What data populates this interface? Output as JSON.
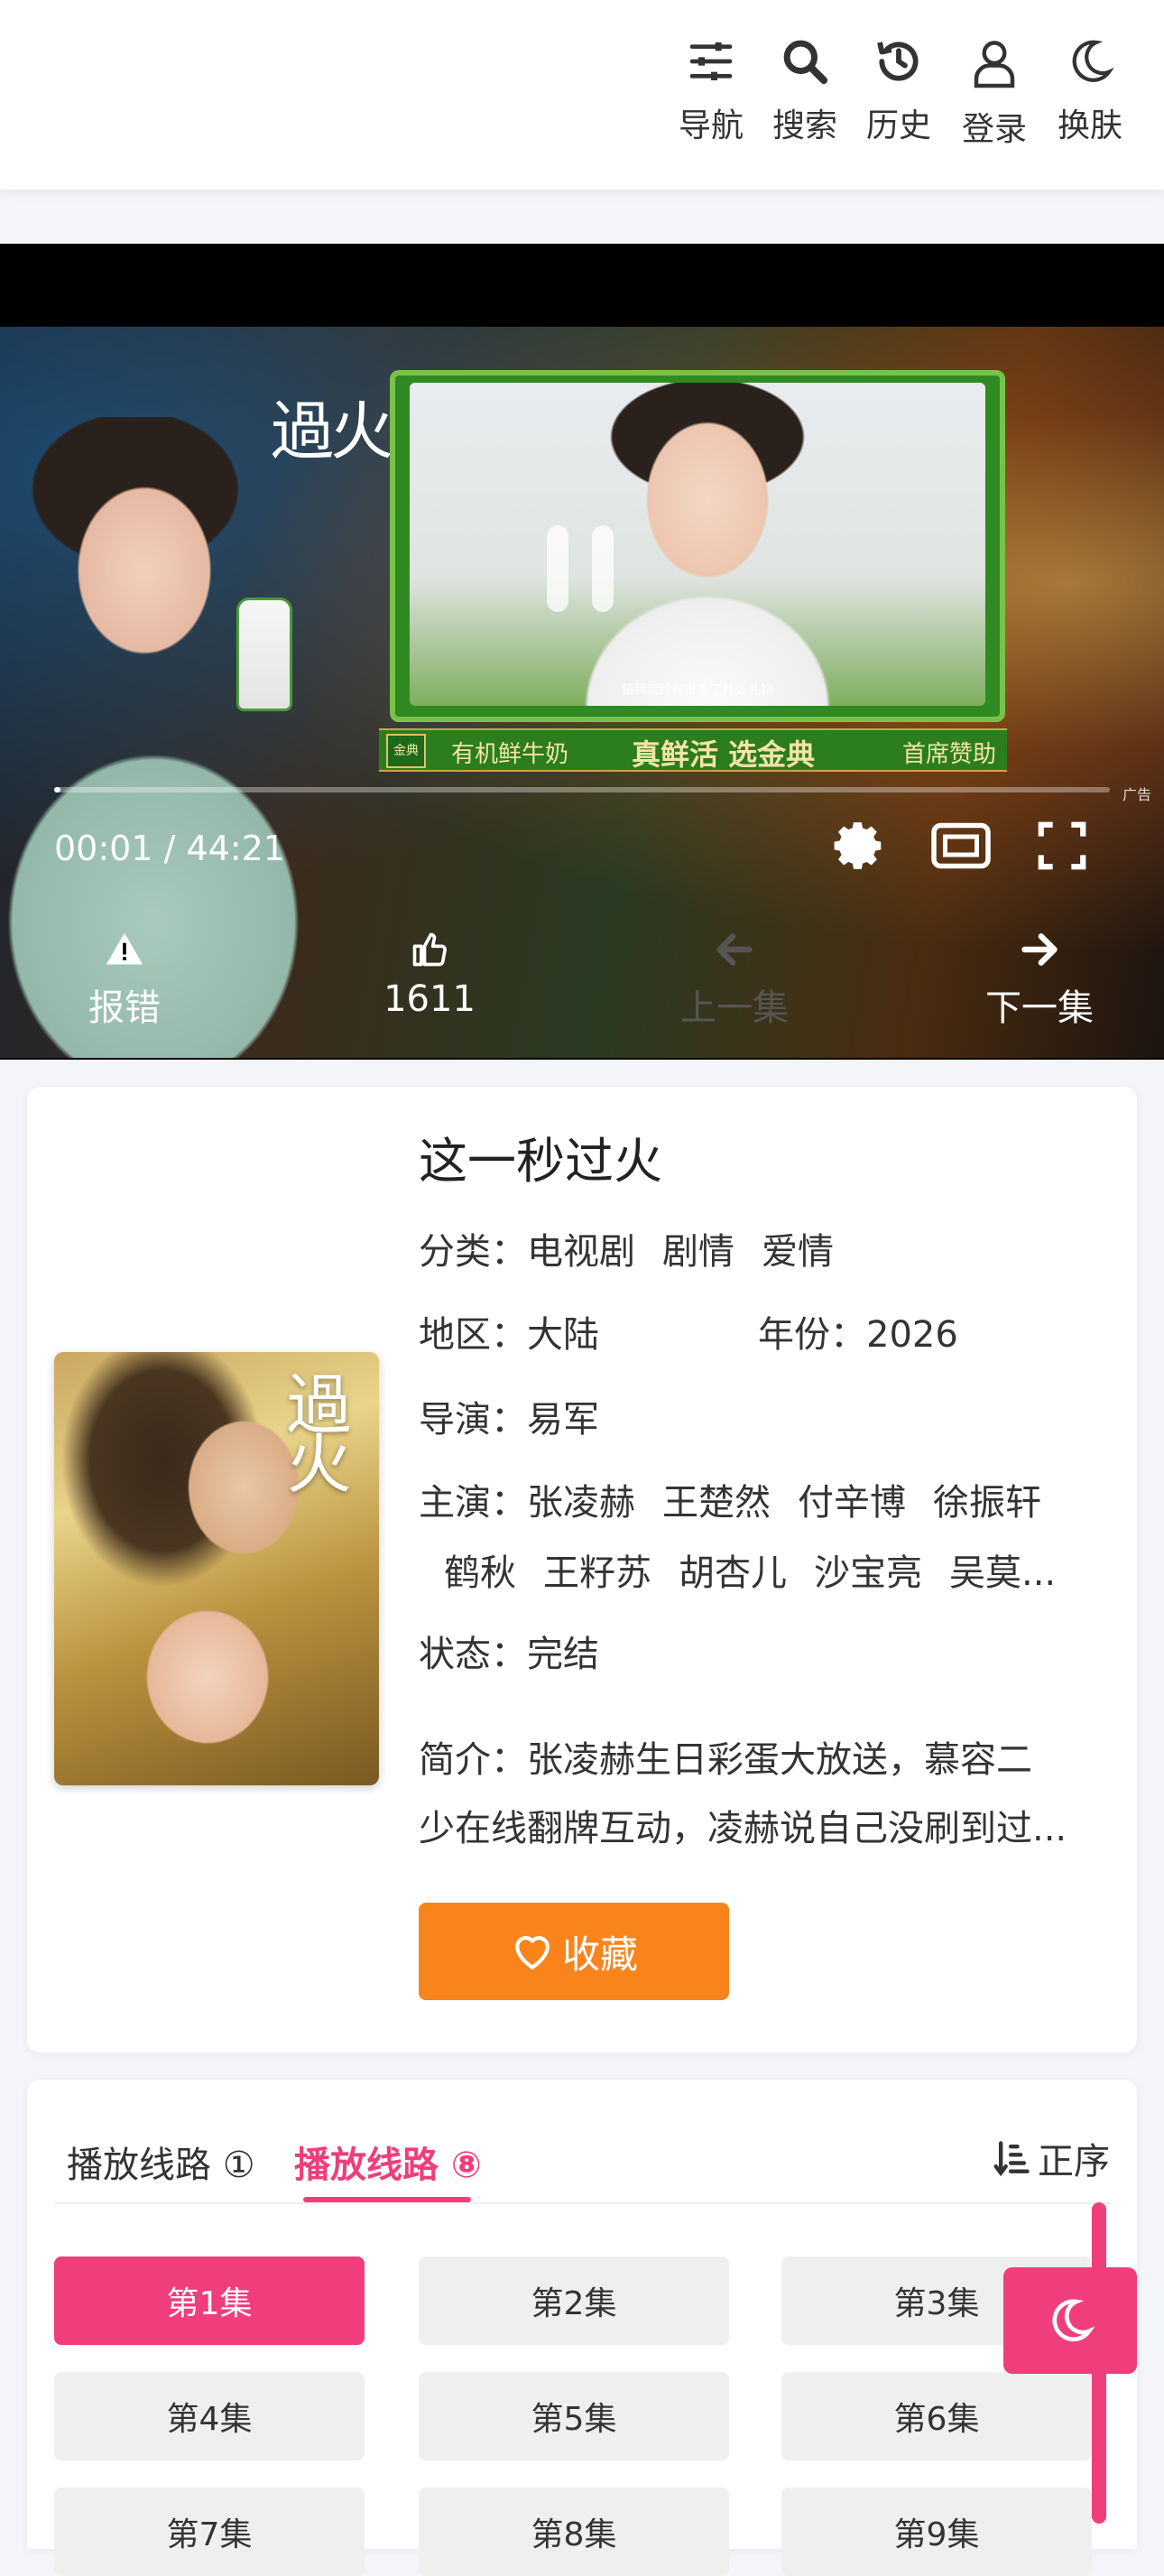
{
  "header": {
    "nav": [
      {
        "label": "导航",
        "icon": "sliders-icon"
      },
      {
        "label": "搜索",
        "icon": "search-icon"
      },
      {
        "label": "历史",
        "icon": "history-icon"
      },
      {
        "label": "登录",
        "icon": "user-icon"
      },
      {
        "label": "换肤",
        "icon": "moon-icon"
      }
    ]
  },
  "player": {
    "ad_caption": "猜猜我给你准备了什么礼物",
    "ad_brand_left": "過火",
    "ad_strip": {
      "logo": "金典",
      "item1": "有机鲜牛奶",
      "item2": "真鲜活 选金典",
      "item3": "首席赞助"
    },
    "ad_tag": "广告",
    "progress": 0.0004,
    "time": "00:01 / 44:21",
    "actions": [
      {
        "label": "报错",
        "icon": "warning-icon",
        "enabled": true
      },
      {
        "label": "1611",
        "icon": "thumbs-up-icon",
        "enabled": true
      },
      {
        "label": "上一集",
        "icon": "arrow-left-icon",
        "enabled": false
      },
      {
        "label": "下一集",
        "icon": "arrow-right-icon",
        "enabled": true
      }
    ]
  },
  "info": {
    "poster_title": "過火",
    "title": "这一秒过火",
    "category_label": "分类：",
    "categories": [
      "电视剧",
      "剧情",
      "爱情"
    ],
    "region_label": "地区：",
    "region": "大陆",
    "year_label": "年份：",
    "year": "2026",
    "director_label": "导演：",
    "director": "易军",
    "cast_label": "主演：",
    "cast_line1": [
      "张凌赫",
      "王楚然",
      "付辛博",
      "徐振轩"
    ],
    "cast_line2": [
      "鹤秋",
      "王籽苏",
      "胡杏儿",
      "沙宝亮",
      "吴莫..."
    ],
    "status_label": "状态：",
    "status": "完结",
    "desc_line1": "简介：张凌赫生日彩蛋大放送，慕容二",
    "desc_line2": "少在线翻牌互动，凌赫说自己没刷到过...",
    "fav_label": "收藏"
  },
  "episodes": {
    "tabs": [
      {
        "label": "播放线路 ①",
        "active": false
      },
      {
        "label": "播放线路 ⑧",
        "active": true
      }
    ],
    "sort_label": "正序",
    "items": [
      "第1集",
      "第2集",
      "第3集",
      "第4集",
      "第5集",
      "第6集",
      "第7集",
      "第8集",
      "第9集"
    ],
    "active_index": 0
  },
  "colors": {
    "accent": "#f03d7c",
    "fav": "#f9841c"
  }
}
